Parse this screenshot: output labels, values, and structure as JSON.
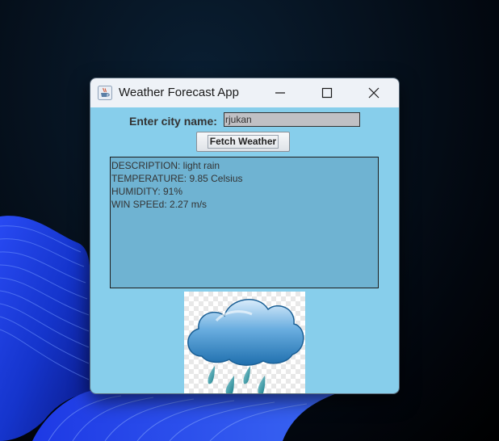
{
  "window": {
    "title": "Weather Forecast App",
    "app_icon": "java-cup-icon",
    "controls": [
      "minimize-icon",
      "maximize-icon",
      "close-icon"
    ]
  },
  "form": {
    "city_label": "Enter city name:",
    "city_value": "rjukan",
    "fetch_button_label": "Fetch Weather"
  },
  "result": {
    "lines": [
      "DESCRIPTION: light rain",
      "TEMPERATURE: 9.85 Celsius",
      "HUMIDITY: 91%",
      "WIN SPEEd: 2.27 m/s"
    ]
  },
  "weather_image": {
    "icon": "rain-cloud-icon"
  },
  "colors": {
    "content_background": "#87ceeb",
    "result_background": "#6fb3d2",
    "input_background": "#c0c0c4",
    "titlebar_background": "#eef2f7"
  }
}
